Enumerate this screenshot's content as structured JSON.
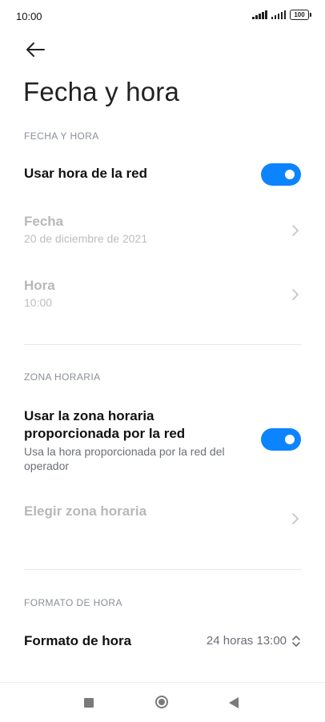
{
  "status_bar": {
    "time": "10:00",
    "battery": "100"
  },
  "header": {
    "title": "Fecha y hora"
  },
  "sections": {
    "date_time": "FECHA Y HORA",
    "time_zone": "ZONA HORARIA",
    "time_format": "FORMATO DE HORA"
  },
  "network_time": {
    "label": "Usar hora de la red",
    "enabled": true
  },
  "date": {
    "label": "Fecha",
    "value": "20 de diciembre de 2021"
  },
  "time": {
    "label": "Hora",
    "value": "10:00"
  },
  "network_timezone": {
    "label_line1": "Usar la zona horaria",
    "label_line2": "proporcionada por la red",
    "subtitle": "Usa la hora proporcionada por la red del operador",
    "enabled": true
  },
  "choose_timezone": {
    "label": "Elegir zona horaria"
  },
  "format": {
    "label": "Formato de hora",
    "value": "24 horas 13:00"
  },
  "colors": {
    "accent": "#0d84ff",
    "disabled_text": "#b8b8b8",
    "section_text": "#8a8f99"
  },
  "icons": [
    "back-arrow-icon",
    "chevron-right-icon",
    "up-down-chevron-icon",
    "signal-icon",
    "battery-icon"
  ]
}
